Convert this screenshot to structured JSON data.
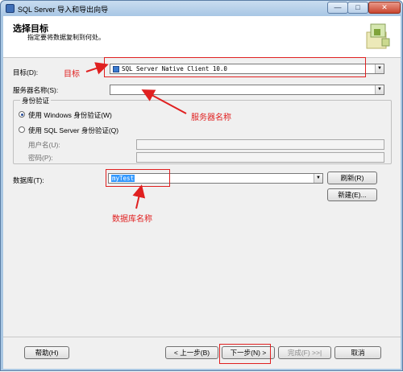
{
  "window": {
    "title": "SQL Server 导入和导出向导",
    "min_glyph": "—",
    "max_glyph": "□",
    "close_glyph": "✕"
  },
  "header": {
    "title": "选择目标",
    "subtitle": "指定要将数据复制到何处。"
  },
  "form": {
    "destination_label": "目标(D):",
    "destination_value": "SQL Server Native Client 10.0",
    "server_label": "服务器名称(S):",
    "server_value": "",
    "auth_group_label": "身份验证",
    "auth_windows_label": "使用 Windows 身份验证(W)",
    "auth_sql_label": "使用 SQL Server 身份验证(Q)",
    "username_label": "用户名(U):",
    "password_label": "密码(P):",
    "database_label": "数据库(T):",
    "database_value": "myTest",
    "refresh_label": "刷新(R)",
    "new_label": "新建(E)..."
  },
  "footer": {
    "help_label": "帮助(H)",
    "back_label": "< 上一步(B)",
    "next_label": "下一步(N) >",
    "finish_label": "完成(F) >>|",
    "cancel_label": "取消"
  },
  "annotations": {
    "destination_note": "目标",
    "server_note": "服务器名称",
    "database_note": "数据库名称",
    "color": "#e02020"
  },
  "selected_auth": "windows"
}
